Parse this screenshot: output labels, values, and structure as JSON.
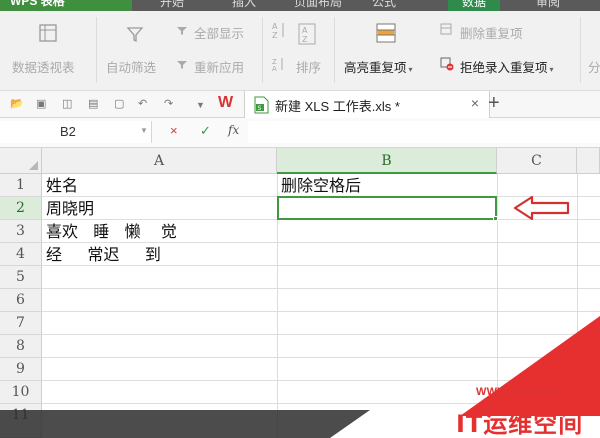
{
  "app": {
    "badge_label": "WPS 表格",
    "tabs": [
      {
        "label": "开始"
      },
      {
        "label": "插入"
      },
      {
        "label": "页面布局"
      },
      {
        "label": "公式"
      },
      {
        "label": "数据",
        "active": true
      },
      {
        "label": "审阅"
      }
    ]
  },
  "ribbon": {
    "pivot_label": "数据透视表",
    "autofilter_label": "自动筛选",
    "show_all_label": "全部显示",
    "reapply_label": "重新应用",
    "sort_label": "排序",
    "highlight_dup_label": "高亮重复项",
    "delete_dup_label": "删除重复项",
    "reject_dup_label": "拒绝录入重复项",
    "split_label": "分"
  },
  "document": {
    "tab_label": "新建 XLS 工作表.xls *",
    "close_symbol": "×",
    "new_tab_symbol": "+"
  },
  "formula_bar": {
    "name_box": "B2",
    "cancel_symbol": "×",
    "confirm_symbol": "✓",
    "fx_label": "fx",
    "value": ""
  },
  "sheet": {
    "columns": [
      "A",
      "B",
      "C"
    ],
    "rows": [
      "1",
      "2",
      "3",
      "4",
      "5",
      "6",
      "7",
      "8",
      "9",
      "10",
      "11"
    ],
    "selected_cell": "B2",
    "cells": {
      "A1": "姓名",
      "B1": "删除空格后",
      "A2": "周晓明",
      "A3": "喜欢   睡   懒    觉",
      "A4": "经     常迟     到"
    }
  },
  "watermark": {
    "url": "WWW.94IP.COM",
    "text": "IT运维空间"
  },
  "colors": {
    "accent_green": "#3f9a3f",
    "arrow_red": "#d33030"
  }
}
